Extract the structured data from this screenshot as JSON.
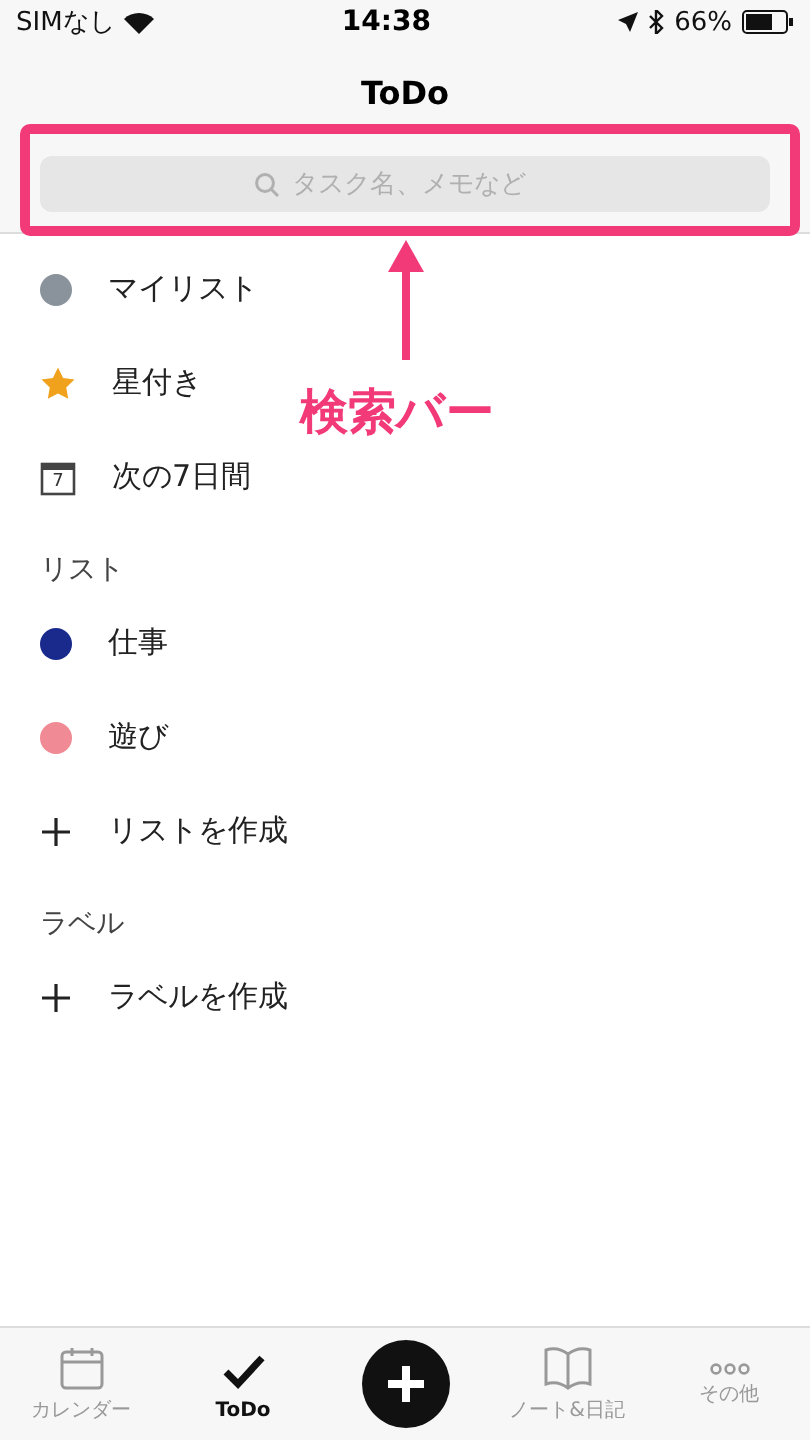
{
  "status_bar": {
    "carrier": "SIMなし",
    "time": "14:38",
    "battery": "66%"
  },
  "nav": {
    "title": "ToDo"
  },
  "search": {
    "placeholder": "タスク名、メモなど"
  },
  "annotation": {
    "label": "検索バー"
  },
  "sections": [
    {
      "items": [
        {
          "kind": "dot",
          "label": "マイリスト",
          "color": "#8a939c"
        },
        {
          "kind": "star",
          "label": "星付き"
        },
        {
          "kind": "calendar",
          "label": "次の7日間",
          "icon_text": "7"
        }
      ]
    },
    {
      "title": "リスト",
      "items": [
        {
          "kind": "dot",
          "label": "仕事",
          "color": "#1a2a8c"
        },
        {
          "kind": "dot",
          "label": "遊び",
          "color": "#f08a94"
        },
        {
          "kind": "add",
          "label": "リストを作成"
        }
      ]
    },
    {
      "title": "ラベル",
      "items": [
        {
          "kind": "add",
          "label": "ラベルを作成"
        }
      ]
    }
  ],
  "tabs": [
    {
      "kind": "calendar",
      "label": "カレンダー",
      "selected": false
    },
    {
      "kind": "check",
      "label": "ToDo",
      "selected": true
    },
    {
      "kind": "plus"
    },
    {
      "kind": "book",
      "label": "ノート&日記",
      "selected": false
    },
    {
      "kind": "more",
      "label": "その他",
      "selected": false
    }
  ]
}
